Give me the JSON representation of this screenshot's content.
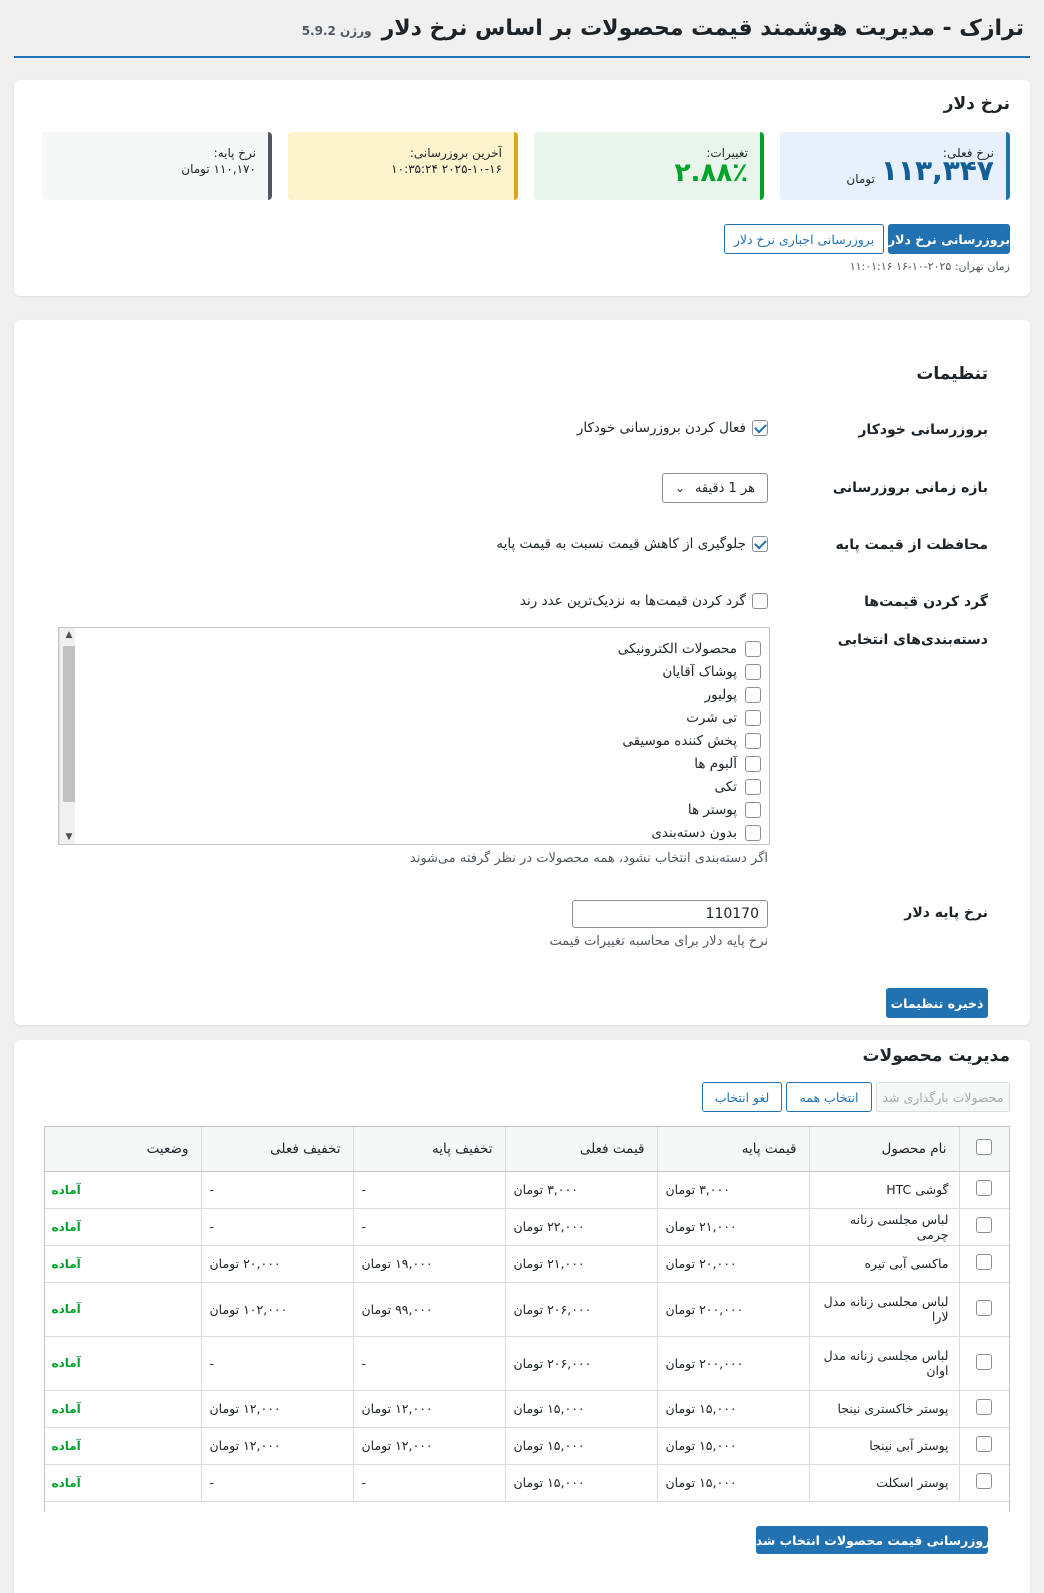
{
  "header": {
    "title": "ترازک - مدیریت هوشمند قیمت محصولات بر اساس نرخ دلار",
    "version": "ورژن 5.9.2"
  },
  "rate_panel": {
    "title": "نرخ دلار",
    "current_label": "نرخ فعلی:",
    "current_value": "۱۱۳,۳۴۷",
    "current_unit": "تومان",
    "change_label": "تغییرات:",
    "change_value": "۲.۸۸٪",
    "last_update_label": "آخرین بروزرسانی:",
    "last_update_value": "۲۰۲۵-۱۰-۱۶ ۱۰:۳۵:۲۴",
    "base_label": "نرخ پایه:",
    "base_value": "۱۱۰,۱۷۰ تومان",
    "update_button": "بروزرسانی نرخ دلار",
    "force_update_button": "بروزرسانی اجباری نرخ دلار",
    "tehran_time": "زمان تهران: ۲۰۲۵-۱۰-۱۶ ۱۱:۰۱:۱۶"
  },
  "settings": {
    "title": "تنظیمات",
    "auto_update_label": "بروزرسانی خودکار",
    "auto_update_text": "فعال کردن بروزرسانی خودکار",
    "interval_label": "بازه زمانی بروزرسانی",
    "interval_value": "هر 1 دقیقه",
    "protect_label": "محافظت از قیمت پایه",
    "protect_text": "جلوگیری از کاهش قیمت نسبت به قیمت پایه",
    "round_label": "گرد کردن قیمت‌ها",
    "round_text": "گرد کردن قیمت‌ها به نزدیک‌ترین عدد رند",
    "categories_label": "دسته‌بندی‌های انتخابی",
    "categories": [
      "محصولات الکترونیکی",
      "پوشاک آقایان",
      "پولیور",
      "تی شرت",
      "پخش کننده موسیقی",
      "آلبوم ها",
      "تکی",
      "پوستر ها",
      "بدون دسته‌بندی"
    ],
    "categories_help": "اگر دسته‌بندی انتخاب نشود، همه محصولات در نظر گرفته می‌شوند",
    "base_rate_label": "نرخ پایه دلار",
    "base_rate_value": "110170",
    "base_rate_help": "نرخ پایه دلار برای محاسبه تغییرات قیمت",
    "save_button": "ذخیره تنظیمات"
  },
  "products": {
    "title": "مدیریت محصولات",
    "loaded_button": "محصولات بارگذاری شد",
    "select_all_button": "انتخاب همه",
    "deselect_button": "لغو انتخاب",
    "columns": [
      "نام محصول",
      "قیمت پایه",
      "قیمت فعلی",
      "تخفیف پایه",
      "تخفیف فعلی",
      "وضعیت"
    ],
    "rows": [
      {
        "name": "گوشی HTC",
        "base": "۳,۰۰۰ تومان",
        "current": "۳,۰۰۰ تومان",
        "base_discount": "-",
        "current_discount": "-",
        "status": "آماده"
      },
      {
        "name": "لباس مجلسی زنانه چرمی",
        "base": "۲۱,۰۰۰ تومان",
        "current": "۲۲,۰۰۰ تومان",
        "base_discount": "-",
        "current_discount": "-",
        "status": "آماده"
      },
      {
        "name": "ماکسی آبی تیره",
        "base": "۲۰,۰۰۰ تومان",
        "current": "۲۱,۰۰۰ تومان",
        "base_discount": "۱۹,۰۰۰ تومان",
        "current_discount": "۲۰,۰۰۰ تومان",
        "status": "آماده"
      },
      {
        "name": "لباس مجلسی زنانه مدل لارا",
        "base": "۲۰۰,۰۰۰ تومان",
        "current": "۲۰۶,۰۰۰ تومان",
        "base_discount": "۹۹,۰۰۰ تومان",
        "current_discount": "۱۰۲,۰۰۰ تومان",
        "status": "آماده"
      },
      {
        "name": "لباس مجلسی زنانه مدل اوان",
        "base": "۲۰۰,۰۰۰ تومان",
        "current": "۲۰۶,۰۰۰ تومان",
        "base_discount": "-",
        "current_discount": "-",
        "status": "آماده"
      },
      {
        "name": "پوستر خاکستری نینجا",
        "base": "۱۵,۰۰۰ تومان",
        "current": "۱۵,۰۰۰ تومان",
        "base_discount": "۱۲,۰۰۰ تومان",
        "current_discount": "۱۲,۰۰۰ تومان",
        "status": "آماده"
      },
      {
        "name": "پوستر آبی نینجا",
        "base": "۱۵,۰۰۰ تومان",
        "current": "۱۵,۰۰۰ تومان",
        "base_discount": "۱۲,۰۰۰ تومان",
        "current_discount": "۱۲,۰۰۰ تومان",
        "status": "آماده"
      },
      {
        "name": "پوستر اسکلت",
        "base": "۱۵,۰۰۰ تومان",
        "current": "۱۵,۰۰۰ تومان",
        "base_discount": "-",
        "current_discount": "-",
        "status": "آماده"
      }
    ],
    "update_selected_button": "بروزرسانی قیمت محصولات انتخاب شده"
  },
  "colors": {
    "accent": "#2271b1",
    "success": "#00a32a",
    "warning": "#dba617"
  }
}
